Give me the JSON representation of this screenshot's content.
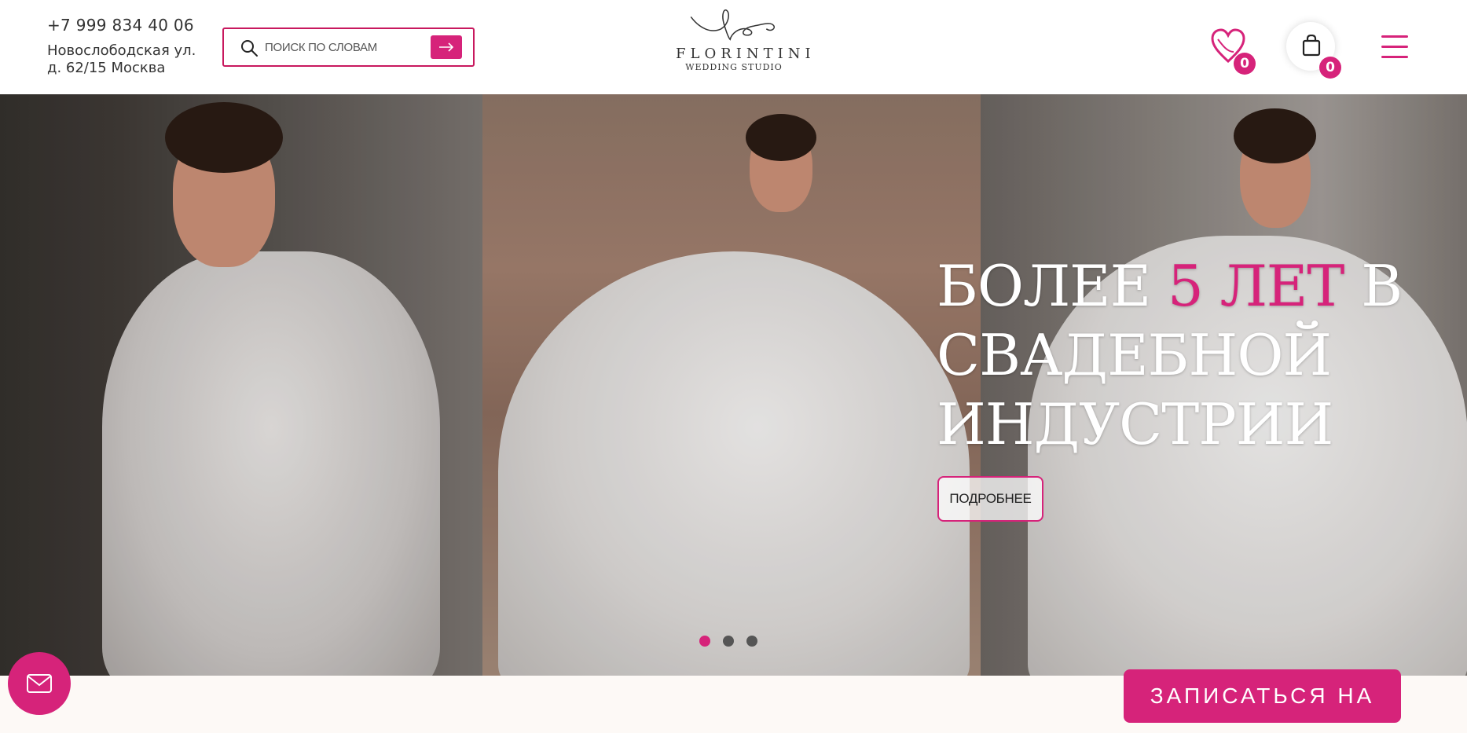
{
  "header": {
    "phone": "+7 999 834 40 06",
    "address_line1": "Новослободская ул.",
    "address_line2": "д. 62/15 Москва",
    "search": {
      "placeholder": "поиск по словам"
    },
    "logo": {
      "name": "FLORINTINI",
      "subtitle": "WEDDING STUDIO"
    },
    "favorites_count": "0",
    "cart_count": "0"
  },
  "hero": {
    "headline_part1": "БОЛЕЕ ",
    "headline_accent": "5 ЛЕТ",
    "headline_part2": " В СВАДЕБНОЙ ИНДУСТРИИ",
    "more_button": "ПОДРОБНЕЕ",
    "slides_total": 3,
    "active_slide": 1
  },
  "footer": {
    "book_button": "ЗАПИСАТЬСЯ НА ПРИМЕРКУ"
  },
  "colors": {
    "accent": "#d6237a",
    "background": "#fdf9f6"
  },
  "icons": [
    "search-icon",
    "arrow-right-icon",
    "heart-icon",
    "shopping-bag-icon",
    "menu-icon",
    "mail-icon"
  ]
}
